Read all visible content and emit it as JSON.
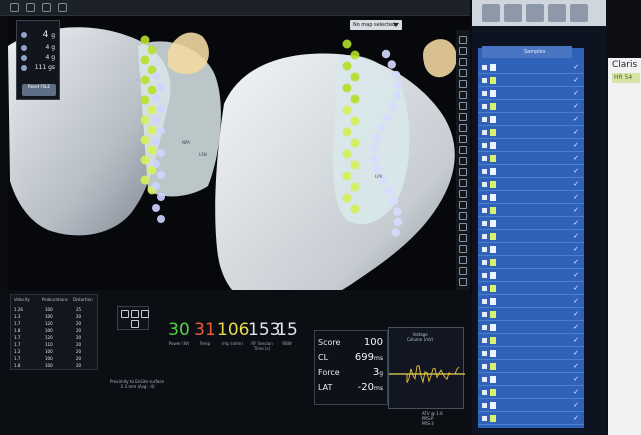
{
  "topbar": {
    "map_selector": "No map selected"
  },
  "stats_panel": {
    "rows": [
      {
        "label": "4",
        "unit": "g"
      },
      {
        "label": "4",
        "unit": "g"
      },
      {
        "label": "4",
        "unit": "g"
      },
      {
        "label": "111",
        "unit": "gs"
      }
    ],
    "reset_button": "Reset FSLE"
  },
  "map_labels": {
    "left_view_label_1": "NPA",
    "left_view_label_2": "LSN",
    "right_view_label_1": "LPV"
  },
  "table": {
    "headers": [
      "Velocity",
      "Peakurations",
      "Distortion"
    ],
    "rows": [
      [
        "1.26",
        "100",
        "25"
      ],
      [
        "1.3",
        "100",
        "20"
      ],
      [
        "1.7",
        "120",
        "20"
      ],
      [
        "1.8",
        "100",
        "20"
      ],
      [
        "1.7",
        "120",
        "20"
      ],
      [
        "1.7",
        "110",
        "20"
      ],
      [
        "1.2",
        "100",
        "20"
      ],
      [
        "1.7",
        "100",
        "20"
      ],
      [
        "1.8",
        "100",
        "20"
      ]
    ]
  },
  "metrics": [
    {
      "value": "30",
      "label": "Power (W)",
      "color": "#56d24c"
    },
    {
      "value": "31",
      "label": "Temp",
      "color": "#ef5e39"
    },
    {
      "value": "106",
      "label": "Imp (ohm)",
      "color": "#e8dc4b"
    },
    {
      "value": "153",
      "label": "RF Session Time (s)",
      "color": "#e7edf4"
    },
    {
      "value": "15",
      "label": "RBW",
      "color": "#e7edf4"
    }
  ],
  "score_panel": {
    "score_label": "Score",
    "score_value": "100",
    "cl_label": "CL",
    "cl_value": "699",
    "cl_unit": "ms",
    "force_label": "Force",
    "force_value": "3",
    "force_unit": "g",
    "lat_label": "LAT",
    "lat_value": "-20",
    "lat_unit": "ms"
  },
  "voltage_panel": {
    "title": "Voltage",
    "subtitle": "Column (mV)"
  },
  "footer": {
    "proximity": "Proximity to EnSite surface",
    "proximity_sub": "-2.3 mm (Avg: -4)",
    "atv": "ATV @ 1-6",
    "prs": "PRS-P",
    "prs2": "PRS-3"
  },
  "right_panel": {
    "header": "Samples"
  },
  "far_right": {
    "title": "Claris",
    "hr_label": "HR 54"
  }
}
